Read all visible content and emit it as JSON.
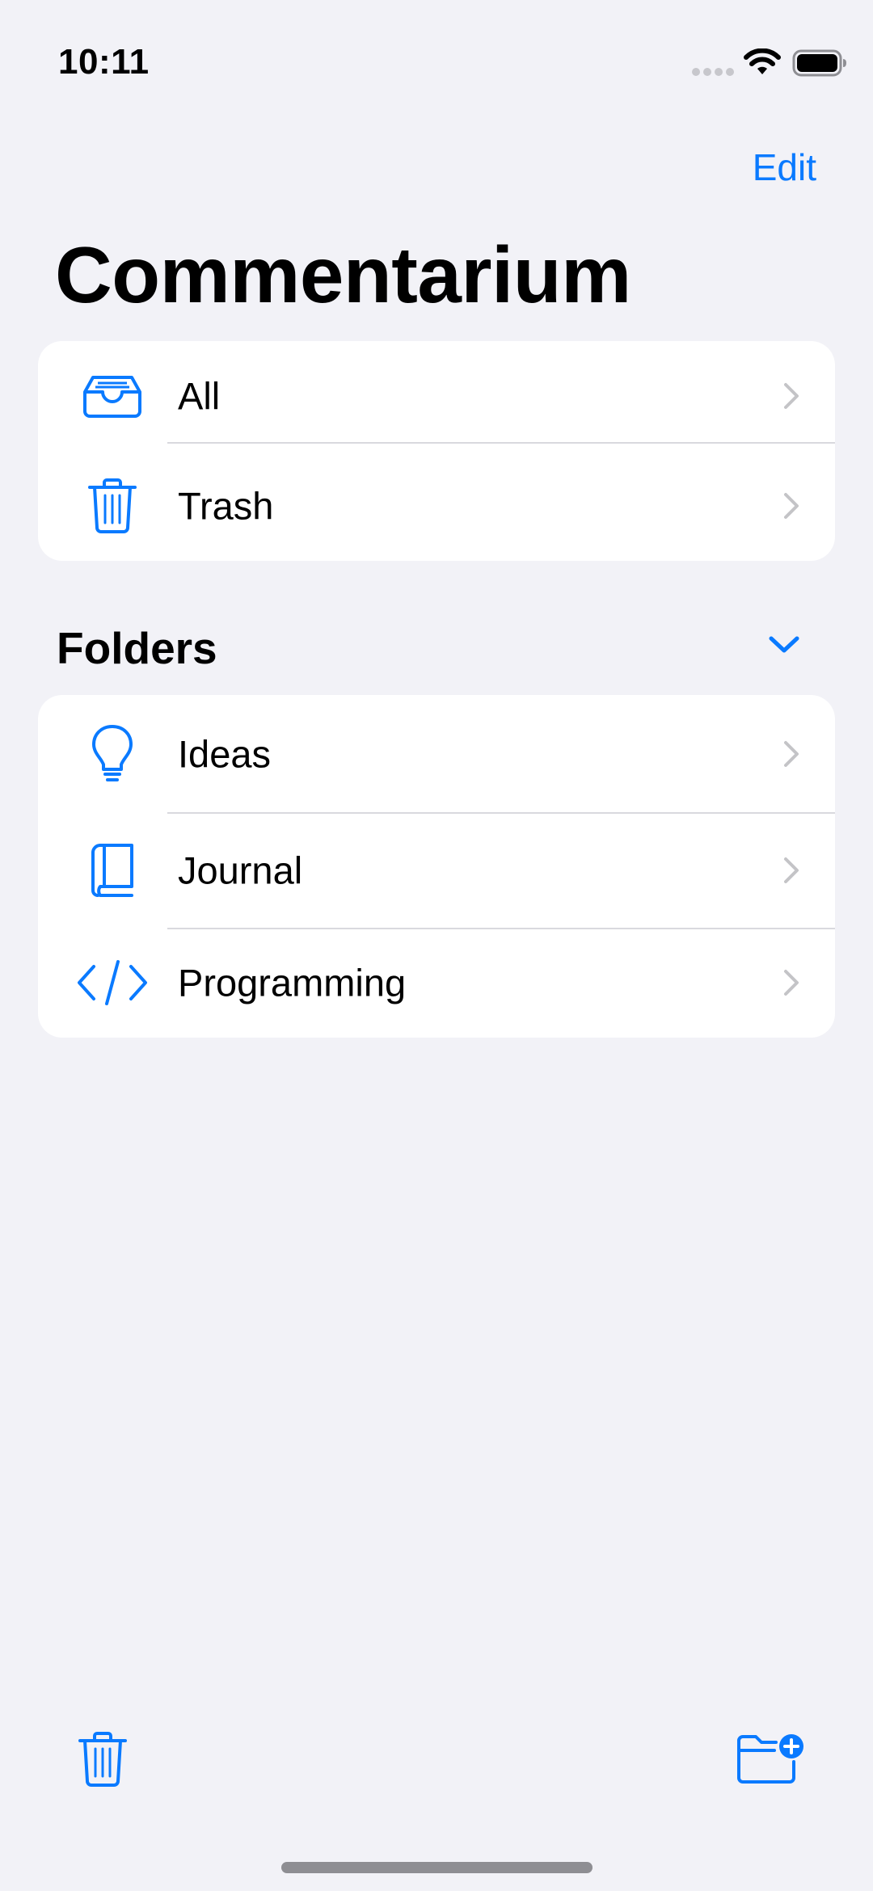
{
  "status_bar": {
    "time": "10:11"
  },
  "nav": {
    "edit_label": "Edit",
    "title": "Commentarium"
  },
  "main_group": {
    "items": [
      {
        "label": "All",
        "icon": "tray-icon"
      },
      {
        "label": "Trash",
        "icon": "trash-icon"
      }
    ]
  },
  "folders": {
    "header": "Folders",
    "items": [
      {
        "label": "Ideas",
        "icon": "lightbulb-icon"
      },
      {
        "label": "Journal",
        "icon": "book-icon"
      },
      {
        "label": "Programming",
        "icon": "code-icon"
      }
    ]
  },
  "toolbar": {
    "left_icon": "trash-icon",
    "right_icon": "folder-badge-plus-icon"
  },
  "colors": {
    "accent": "#0A7AFF",
    "background": "#F2F2F7",
    "chevron": "#C4C4C7"
  }
}
